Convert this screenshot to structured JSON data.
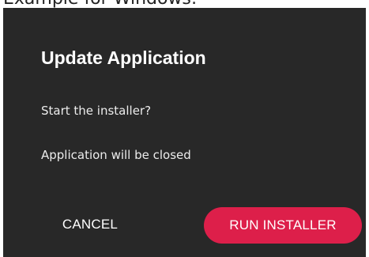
{
  "caption": "Example for Windows:",
  "dialog": {
    "title": "Update Application",
    "message_line1": "Start the installer?",
    "message_line2": "Application will be closed",
    "buttons": {
      "cancel_label": "CANCEL",
      "run_label": "RUN INSTALLER"
    }
  },
  "colors": {
    "dialog_background": "#282828",
    "accent": "#dd1f4a",
    "text": "#ffffff"
  }
}
